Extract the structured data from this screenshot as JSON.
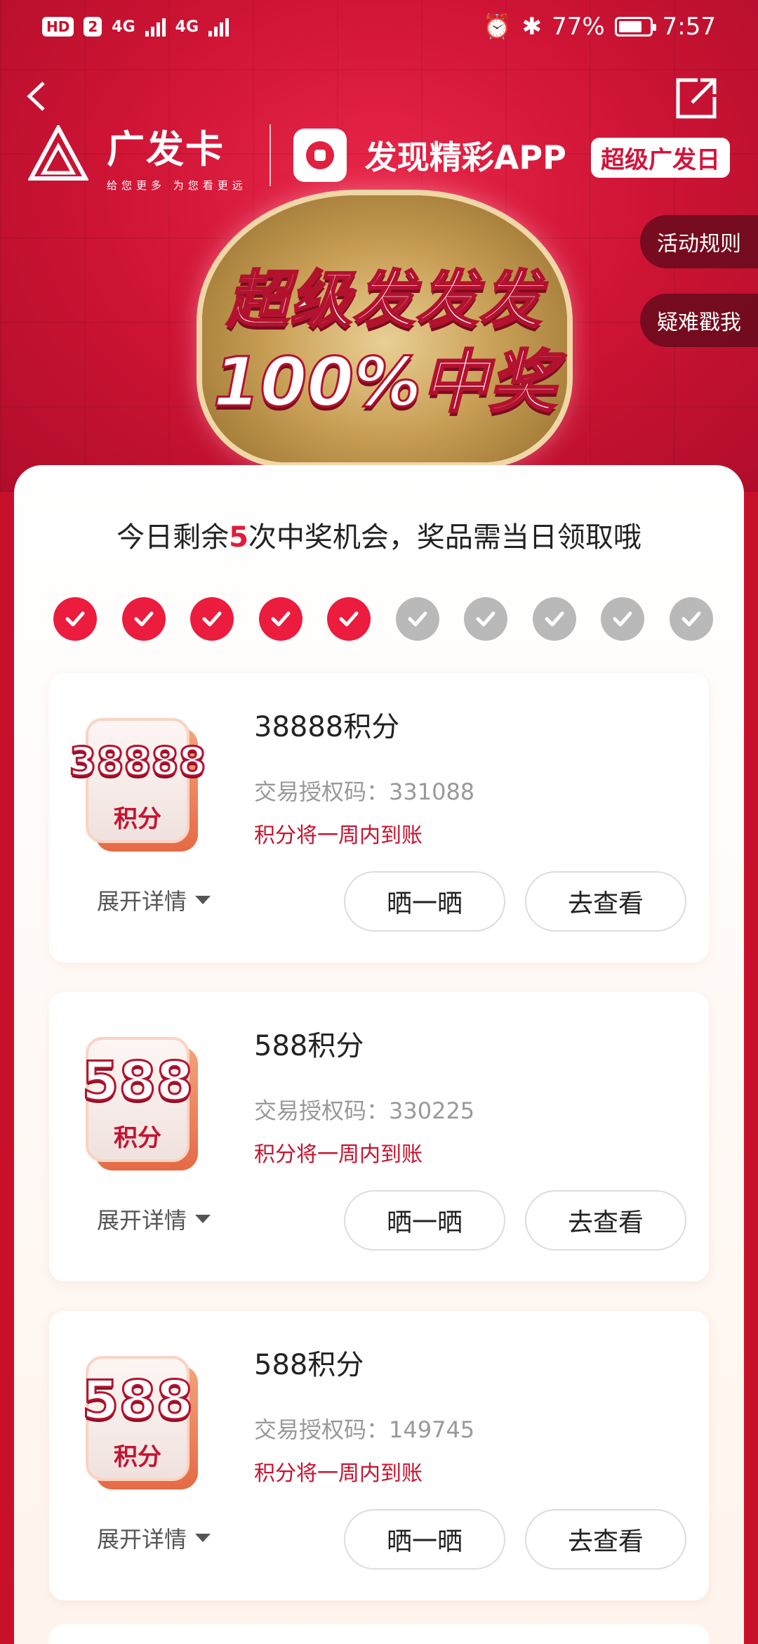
{
  "status_bar": {
    "left_badges": [
      "HD",
      "2",
      "4G",
      "4G"
    ],
    "battery": "77%",
    "battery_level": 0.77,
    "time": "7:57"
  },
  "header": {
    "brand": "广发卡",
    "brand_sub": "给您更多  为您看更远",
    "app_name": "发现精彩APP",
    "super_badge": "超级广发日"
  },
  "side_buttons": {
    "rules": "活动规则",
    "help": "疑难戳我"
  },
  "banner": {
    "line1": "超级发发发",
    "line2": "100%中奖"
  },
  "chances": {
    "prefix": "今日剩余",
    "count": "5",
    "suffix": "次中奖机会，奖品需当日领取哦",
    "used": 5,
    "total": 10
  },
  "prizes": [
    {
      "tile_amount": "38888",
      "tile_unit": "积分",
      "title": "38888积分",
      "code": "交易授权码：331088",
      "note": "积分将一周内到账",
      "expand": "展开详情",
      "share": "晒一晒",
      "view": "去查看"
    },
    {
      "tile_amount": "588",
      "tile_unit": "积分",
      "title": "588积分",
      "code": "交易授权码：330225",
      "note": "积分将一周内到账",
      "expand": "展开详情",
      "share": "晒一晒",
      "view": "去查看"
    },
    {
      "tile_amount": "588",
      "tile_unit": "积分",
      "title": "588积分",
      "code": "交易授权码：149745",
      "note": "积分将一周内到账",
      "expand": "展开详情",
      "share": "晒一晒",
      "view": "去查看"
    }
  ],
  "colors": {
    "brand_red": "#c9102a",
    "accent_red": "#ec1c3e",
    "check_off": "#b9b9b9"
  }
}
